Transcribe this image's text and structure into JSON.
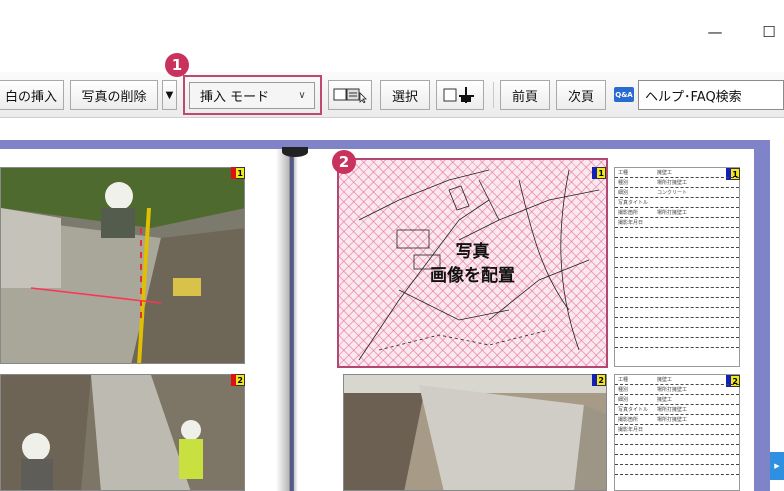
{
  "window": {
    "minimize_glyph": "—",
    "maximize_glyph": "☐"
  },
  "toolbar": {
    "insert_margin_label": "白の挿入",
    "delete_photo_label": "写真の削除",
    "mode_select": {
      "value": "挿入 モード",
      "chevron": "∨"
    },
    "select_label": "選択",
    "prev_page_label": "前頁",
    "next_page_label": "次頁",
    "qa_icon_text": "Q&A",
    "help_search_value": "ヘルプ･FAQ検索"
  },
  "callouts": [
    "1",
    "2"
  ],
  "placeholder": {
    "line1": "写真",
    "line2": "画像を配置"
  },
  "slots": [
    {
      "number": "1"
    },
    {
      "number": "2"
    }
  ],
  "info_box_1": {
    "number": "1",
    "rows": [
      {
        "k": "工種",
        "v": "擁壁工"
      },
      {
        "k": "種別",
        "v": "場所打擁壁工"
      },
      {
        "k": "細別",
        "v": "コンクリート"
      },
      {
        "k": "写真タイトル",
        "v": ""
      },
      {
        "k": "撮影箇所",
        "v": "場所打擁壁工"
      },
      {
        "k": "撮影年月日",
        "v": ""
      }
    ]
  },
  "info_box_2": {
    "number": "2",
    "rows": [
      {
        "k": "工種",
        "v": "擁壁工"
      },
      {
        "k": "種別",
        "v": "場所打擁壁工"
      },
      {
        "k": "細別",
        "v": "擁壁工"
      },
      {
        "k": "写真タイトル",
        "v": "場所打擁壁工"
      },
      {
        "k": "撮影箇所",
        "v": "場所打擁壁工"
      },
      {
        "k": "撮影年月日",
        "v": ""
      }
    ]
  }
}
